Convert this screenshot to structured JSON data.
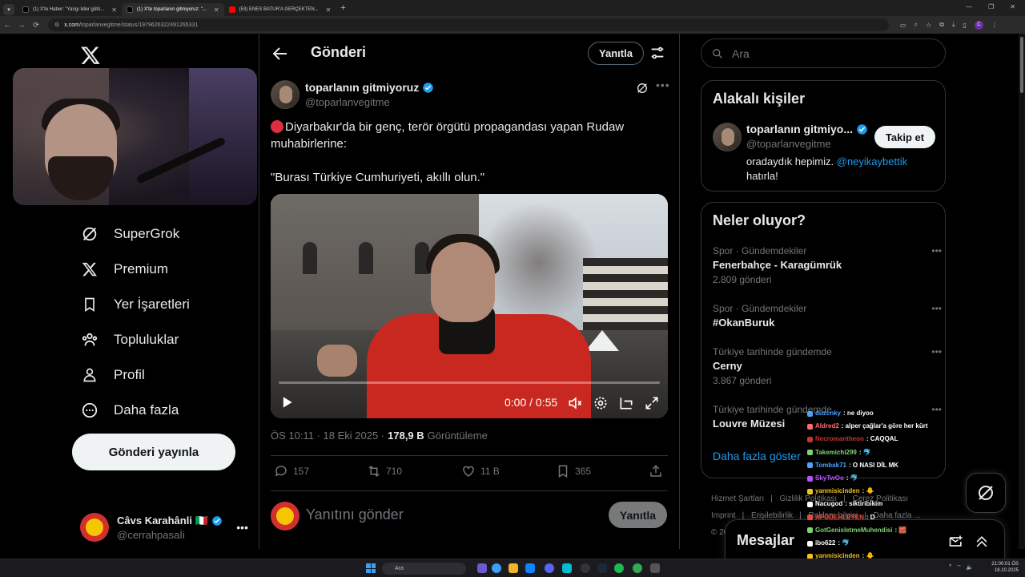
{
  "browser": {
    "tabs": [
      {
        "title": "(1) X'te Haber: \"Yangı lider götü...",
        "active": false,
        "favicon": "x-favicon"
      },
      {
        "title": "(1) X'te toparlanın gitmiyoruz: \"...",
        "active": true,
        "favicon": "x-favicon"
      },
      {
        "title": "(53) ENES BATUR'A GERÇEKTEN...",
        "active": false,
        "favicon": "youtube-favicon"
      }
    ],
    "url_host": "x.com",
    "url_path": "/toparlanvegitme/status/1979626322491265331"
  },
  "sidebar": {
    "items": [
      {
        "label": "SuperGrok",
        "icon": "grok-icon"
      },
      {
        "label": "Premium",
        "icon": "x-logo-icon"
      },
      {
        "label": "Yer İşaretleri",
        "icon": "bookmark-icon"
      },
      {
        "label": "Topluluklar",
        "icon": "communities-icon"
      },
      {
        "label": "Profil",
        "icon": "profile-icon"
      },
      {
        "label": "Daha fazla",
        "icon": "more-circle-icon"
      }
    ],
    "post_button": "Gönderi yayınla",
    "account": {
      "name": "Câvs Karahânli 🇮🇹",
      "handle": "@cerrahpasaİi"
    }
  },
  "main": {
    "header_title": "Gönderi",
    "reply_pill": "Yanıtla",
    "post": {
      "author_name": "toparlanın gitmiyoruz",
      "author_handle": "@toparlanvegitme",
      "text_line1": "Diyarbakır'da bir genç, terör örgütü propagandası yapan Rudaw muhabirlerine:",
      "text_line2": "\"Burası Türkiye Cumhuriyeti, akıllı olun.\"",
      "video_time": "0:00 / 0:55",
      "timestamp": "ÖS 10:11 · 18 Eki 2025 ·",
      "views_count": "178,9 B",
      "views_label": "Görüntüleme",
      "replies": "157",
      "reposts": "710",
      "likes": "11 B",
      "bookmarks": "365"
    },
    "reply_placeholder": "Yanıtını gönder",
    "reply_button": "Yanıtla"
  },
  "right": {
    "search_placeholder": "Ara",
    "related": {
      "title": "Alakalı kişiler",
      "name": "toparlanın gitmiyo...",
      "handle": "@toparlanvegitme",
      "follow": "Takip et",
      "bio_text": "oradaydık hepimiz.",
      "bio_mention": "@neyikaybettik",
      "bio_end": "hatırla!"
    },
    "trends": {
      "title": "Neler oluyor?",
      "items": [
        {
          "category": "Spor · Gündemdekiler",
          "name": "Fenerbahçe - Karagümrük",
          "count": "2.809 gönderi"
        },
        {
          "category": "Spor · Gündemdekiler",
          "name": "#OkanBuruk",
          "count": ""
        },
        {
          "category": "Türkiye tarihinde gündemde",
          "name": "Cerny",
          "count": "3.867 gönderi"
        },
        {
          "category": "Türkiye tarihinde gündemde",
          "name": "Louvre Müzesi",
          "count": ""
        }
      ],
      "show_more": "Daha fazla göster"
    },
    "footer_links": [
      "Hizmet Şartları",
      "Gizlilik Politikası",
      "Çerez Politikası",
      "Imprint",
      "Erişilebilirlik",
      "Reklam bilgisi",
      "Daha fazla ...",
      "© 2025 X Corp."
    ],
    "messages_title": "Mesajlar"
  },
  "chat": [
    {
      "user": "duzcnky",
      "text": ": ne diyoo",
      "color": "#4aa3ff"
    },
    {
      "user": "Aldred2",
      "text": ": alper çağlar'a göre her kürt",
      "color": "#ff6b6b"
    },
    {
      "user": "Necromantheon",
      "text": ": CAQQAL",
      "color": "#c0392b"
    },
    {
      "user": "Takemichi299",
      "text": ": 🐬",
      "color": "#7dd36f"
    },
    {
      "user": "Tombak71",
      "text": ": O NASI DİL MK",
      "color": "#4aa3ff"
    },
    {
      "user": "SkyTwOo",
      "text": ": 🐬",
      "color": "#b452ff"
    },
    {
      "user": "yanmisicinden",
      "text": ": 🐥",
      "color": "#f0c419"
    },
    {
      "user": "Nacugod",
      "text": ": siktiribikim",
      "color": "#ffffff"
    },
    {
      "user": "APODEHLEYEN",
      "text": ": D",
      "color": "#e74c3c"
    },
    {
      "user": "GotGenisletmeMuhendisi",
      "text": ": 🧱",
      "color": "#7dd36f"
    },
    {
      "user": "ibo622",
      "text": ": 🐬",
      "color": "#ffffff"
    },
    {
      "user": "yanmisicinden",
      "text": ": 🐥",
      "color": "#f0c419"
    }
  ],
  "taskbar": {
    "search": "Ara",
    "time": "21:00:01 ÖS",
    "date": "18.10.2025"
  },
  "colors": {
    "accent": "#1d9bf0",
    "verified": "#1d9bf0",
    "background": "#000000",
    "border": "#2f3336"
  }
}
